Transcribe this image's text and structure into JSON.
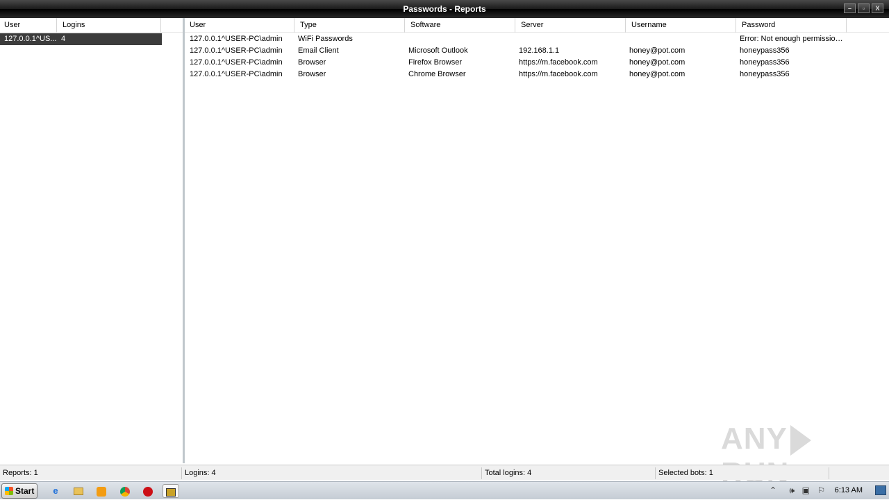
{
  "window": {
    "title": "Passwords - Reports",
    "buttons": {
      "minimize": "–",
      "restore": "▫",
      "close": "X"
    }
  },
  "left_table": {
    "columns": [
      "User",
      "Logins"
    ],
    "rows": [
      {
        "user": "127.0.0.1^US...",
        "logins": "4"
      }
    ]
  },
  "right_table": {
    "columns": [
      "User",
      "Type",
      "Software",
      "Server",
      "Username",
      "Password"
    ],
    "rows": [
      {
        "user": "127.0.0.1^USER-PC\\admin",
        "type": "WiFi Passwords",
        "software": "",
        "server": "",
        "username": "",
        "password": "Error: Not enough permission. ..."
      },
      {
        "user": "127.0.0.1^USER-PC\\admin",
        "type": "Email Client",
        "software": "Microsoft Outlook",
        "server": "192.168.1.1",
        "username": "honey@pot.com",
        "password": "honeypass356"
      },
      {
        "user": "127.0.0.1^USER-PC\\admin",
        "type": "Browser",
        "software": "Firefox Browser",
        "server": "https://m.facebook.com",
        "username": "honey@pot.com",
        "password": "honeypass356"
      },
      {
        "user": "127.0.0.1^USER-PC\\admin",
        "type": "Browser",
        "software": "Chrome Browser",
        "server": "https://m.facebook.com",
        "username": "honey@pot.com",
        "password": "honeypass356"
      }
    ]
  },
  "statusbar": {
    "reports": "Reports: 1",
    "logins": "Logins: 4",
    "total_logins": "Total logins: 4",
    "selected_bots": "Selected bots: 1"
  },
  "watermark": {
    "left": "ANY",
    "right": "RUN"
  },
  "taskbar": {
    "start_label": "Start",
    "clock": "6:13 AM",
    "icons": [
      "internet-explorer-icon",
      "file-explorer-icon",
      "media-player-icon",
      "chrome-icon",
      "opera-icon",
      "app-icon"
    ]
  },
  "colors": {
    "selected_row": "#3c3c3c",
    "titlebar": "#1a1a1a"
  }
}
